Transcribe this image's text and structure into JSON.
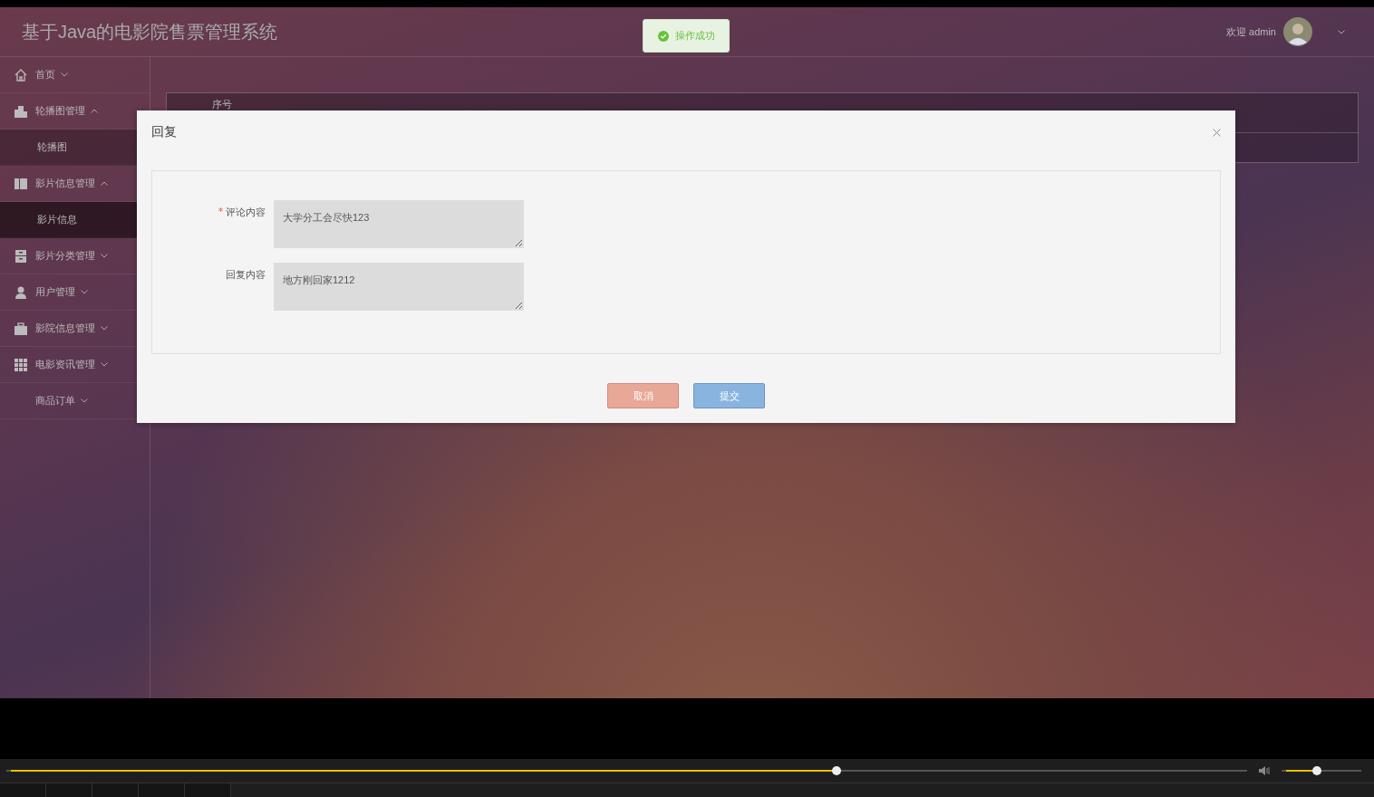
{
  "app": {
    "title": "基于Java的电影院售票管理系统",
    "user_greeting": "欢迎 admin"
  },
  "toast": {
    "kind": "success",
    "message": "操作成功"
  },
  "sidebar": {
    "items": [
      {
        "label": "首页",
        "expanded": false
      },
      {
        "label": "轮播图管理",
        "expanded": true,
        "children": [
          {
            "label": "轮播图",
            "selected": false
          }
        ]
      },
      {
        "label": "影片信息管理",
        "expanded": true,
        "children": [
          {
            "label": "影片信息",
            "selected": true
          }
        ]
      },
      {
        "label": "影片分类管理",
        "expanded": false
      },
      {
        "label": "用户管理",
        "expanded": false
      },
      {
        "label": "影院信息管理",
        "expanded": false
      },
      {
        "label": "电影资讯管理",
        "expanded": false
      },
      {
        "label": "商品订单",
        "expanded": false
      }
    ]
  },
  "table": {
    "columns": [
      "序号"
    ]
  },
  "dialog": {
    "title": "回复",
    "fields": [
      {
        "label": "评论内容",
        "required": true,
        "value": "大学分工会尽快123"
      },
      {
        "label": "回复内容",
        "required": false,
        "value": "地方刚回家1212"
      }
    ],
    "buttons": [
      {
        "label": "取消",
        "kind": "cancel"
      },
      {
        "label": "提交",
        "kind": "submit"
      }
    ]
  },
  "player": {
    "progress": {
      "level": 0.67
    },
    "volume": {
      "level": 0.44
    }
  }
}
